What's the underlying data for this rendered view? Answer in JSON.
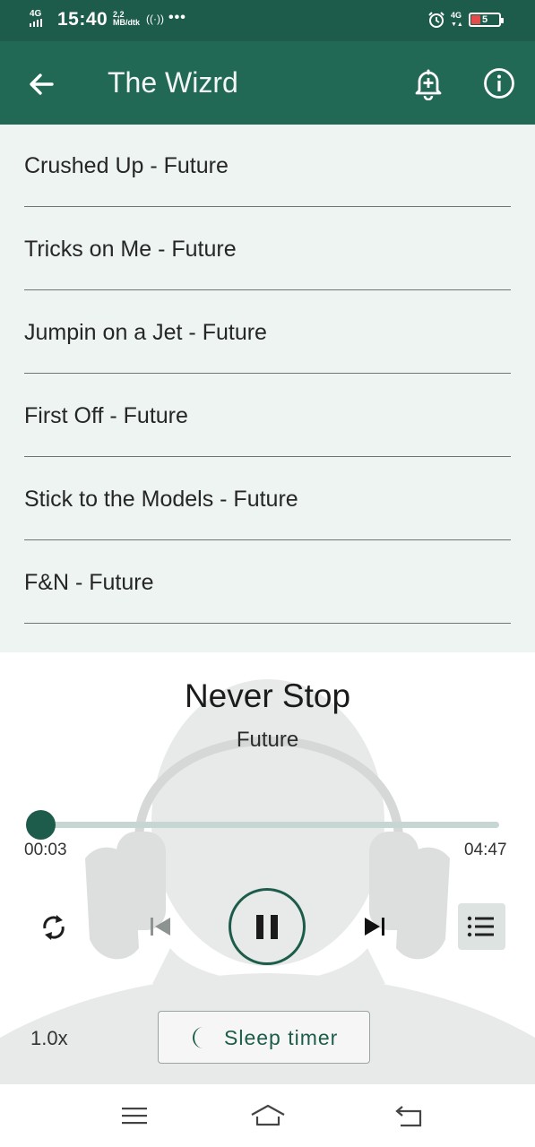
{
  "status_bar": {
    "network": "4G",
    "time": "15:40",
    "data_rate": "2,2",
    "data_rate_unit": "MB/dtk",
    "dots": "•••",
    "network_right": "4G",
    "battery_level": "5",
    "battery_color": "#e44b4b"
  },
  "app_bar": {
    "title": "The Wizrd",
    "icons": [
      "arrow-back-icon",
      "bell-plus-icon",
      "info-icon"
    ]
  },
  "tracks": [
    {
      "label": "Crushed Up - Future"
    },
    {
      "label": "Tricks on Me - Future"
    },
    {
      "label": "Jumpin on a Jet - Future"
    },
    {
      "label": "First Off - Future"
    },
    {
      "label": "Stick to the Models - Future"
    },
    {
      "label": "F&N - Future"
    }
  ],
  "player": {
    "title": "Never Stop",
    "artist": "Future",
    "current_time": "00:03",
    "total_time": "04:47",
    "progress": 0.01,
    "speed": "1.0x",
    "sleep_timer_label": "Sleep timer",
    "controls": [
      "repeat-icon",
      "skip-previous-icon",
      "pause-icon",
      "skip-next-icon",
      "queue-list-icon"
    ],
    "accent_color": "#1d5c4b"
  },
  "nav_bar": {
    "icons": [
      "menu-icon",
      "home-icon",
      "back-nav-icon"
    ]
  },
  "colors": {
    "status_bar": "#1d5c4b",
    "app_bar": "#216855",
    "list_background": "#edf4f2"
  }
}
